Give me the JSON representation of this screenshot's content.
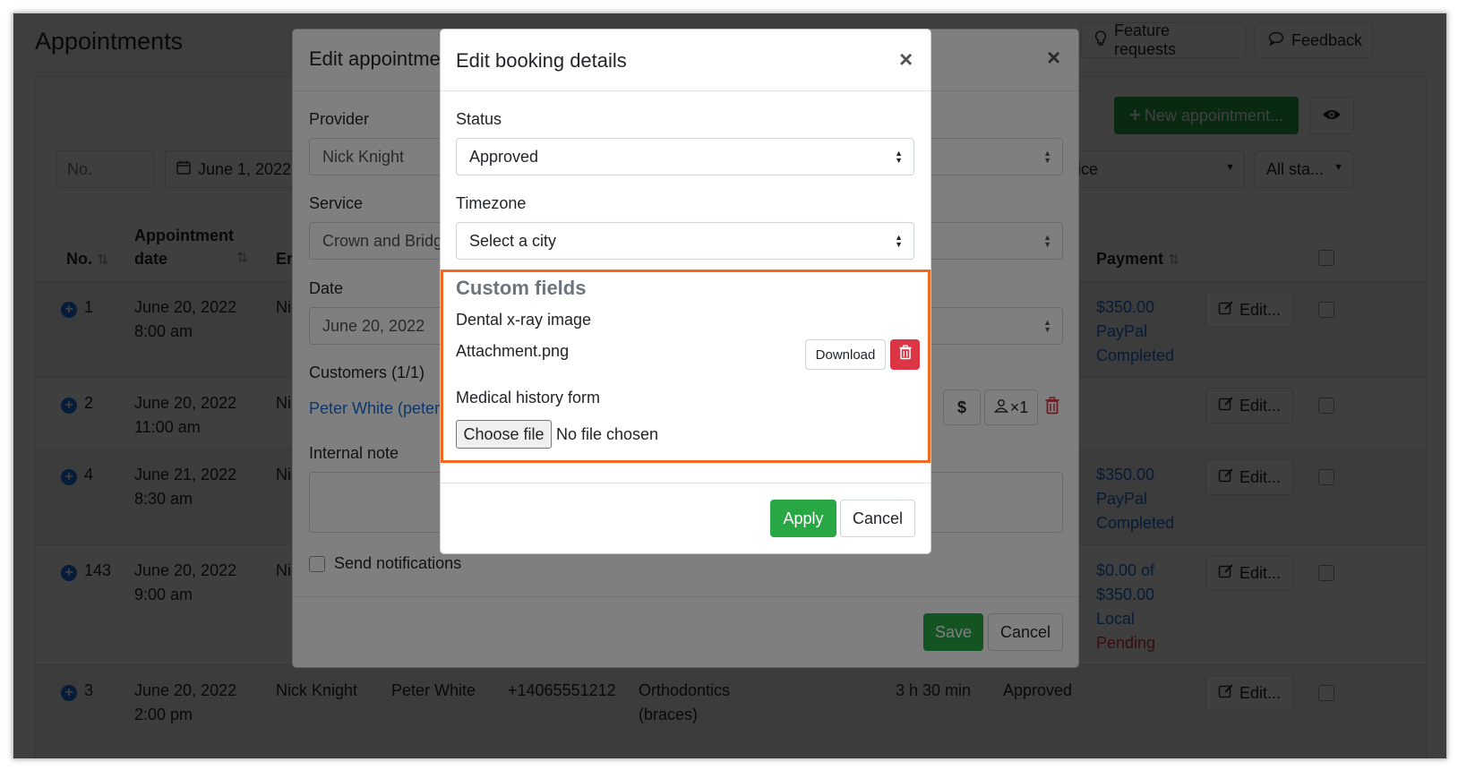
{
  "page": {
    "title": "Appointments"
  },
  "topbar": {
    "feature_requests": "Feature requests",
    "feedback": "Feedback"
  },
  "toolbar": {
    "new_appointment": "New appointment...",
    "partial_button": "..."
  },
  "filters": {
    "number_placeholder": "No.",
    "date": "June 1, 2022",
    "service_partial": "ice",
    "status": "All sta..."
  },
  "table": {
    "headers": {
      "no": "No.",
      "appointment_date": "Appointment date",
      "em_partial": "En",
      "payment": "Payment"
    },
    "rows": [
      {
        "no": "1",
        "date": "June 20, 2022",
        "time": "8:00 am",
        "provider": "Nic",
        "payment": [
          "$350.00",
          "PayPal",
          "Completed"
        ],
        "edit": "Edit..."
      },
      {
        "no": "2",
        "date": "June 20, 2022",
        "time": "11:00 am",
        "provider": "Nic",
        "payment": [],
        "edit": "Edit..."
      },
      {
        "no": "4",
        "date": "June 21, 2022",
        "time": "8:30 am",
        "provider": "Nic",
        "payment": [
          "$350.00",
          "PayPal",
          "Completed"
        ],
        "edit": "Edit..."
      },
      {
        "no": "143",
        "date": "June 20, 2022",
        "time": "9:00 am",
        "provider": "Nic",
        "payment": [
          "$0.00 of",
          "$350.00",
          "Local",
          "Pending"
        ],
        "edit": "Edit..."
      },
      {
        "no": "3",
        "date": "June 20, 2022",
        "time": "2:00 pm",
        "provider": "Nick Knight",
        "customer": "Peter White",
        "phone": "+14065551212",
        "service": [
          "Orthodontics",
          "(braces)"
        ],
        "duration": "3 h 30 min",
        "status": "Approved",
        "edit": "Edit..."
      }
    ]
  },
  "edit_appointment": {
    "title": "Edit appointme",
    "provider_label": "Provider",
    "provider_value": "Nick Knight",
    "service_label": "Service",
    "service_value": "Crown and Bridg",
    "date_label": "Date",
    "date_value": "June 20, 2022",
    "customers_label": "Customers (1/1)",
    "customer_link": "Peter White (peter",
    "customer_badge": "×1",
    "internal_note_label": "Internal note",
    "send_notifications": "Send notifications",
    "save": "Save",
    "cancel": "Cancel"
  },
  "booking_modal": {
    "title": "Edit booking details",
    "status_label": "Status",
    "status_value": "Approved",
    "timezone_label": "Timezone",
    "timezone_value": "Select a city",
    "custom_fields_title": "Custom fields",
    "field1_label": "Dental x-ray image",
    "field1_file": "Attachment.png",
    "download": "Download",
    "field2_label": "Medical history form",
    "choose_file": "Choose file",
    "no_file": "No file chosen",
    "apply": "Apply",
    "cancel": "Cancel"
  },
  "colors": {
    "accent_green": "#28a745",
    "highlight_orange": "#f26a21",
    "danger_red": "#dc3545",
    "link_blue": "#1a6fd6"
  }
}
